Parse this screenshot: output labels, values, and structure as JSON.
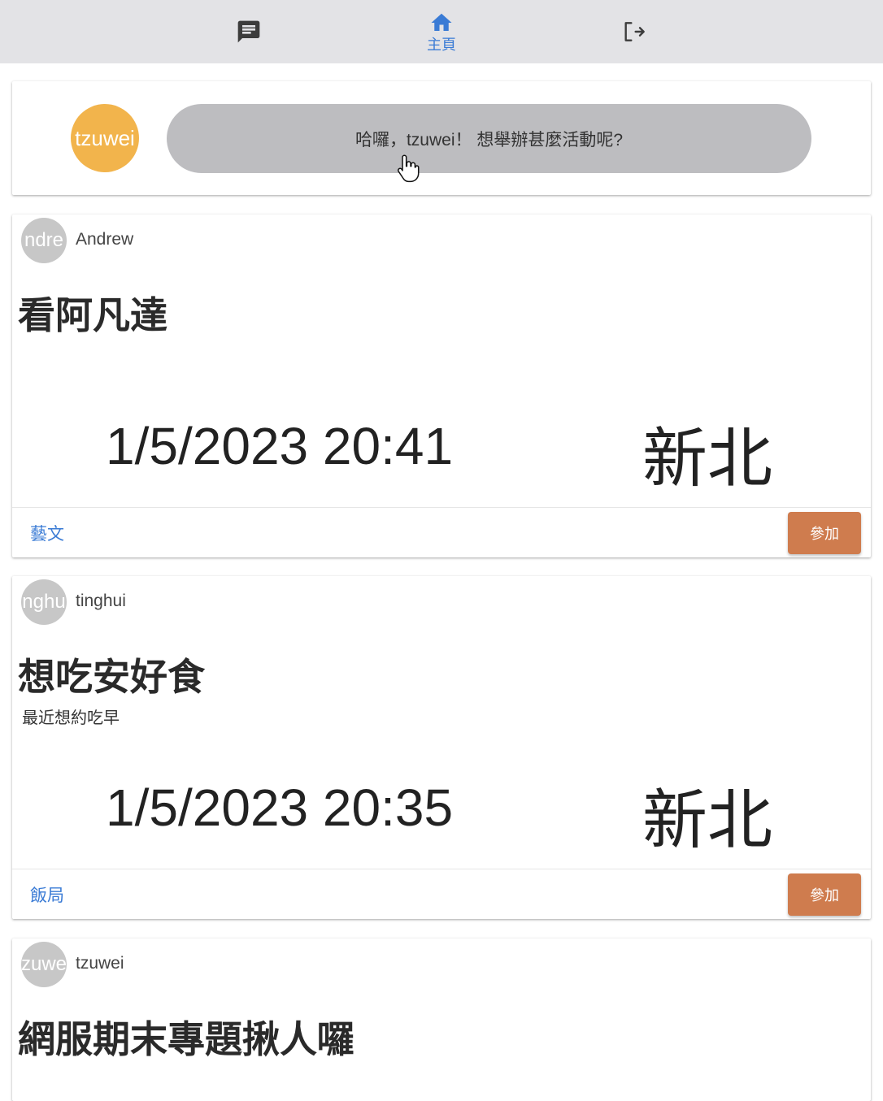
{
  "nav": {
    "items": [
      {
        "icon": "chat-icon",
        "label": ""
      },
      {
        "icon": "home-icon",
        "label": "主頁"
      },
      {
        "icon": "logout-icon",
        "label": ""
      }
    ],
    "active_color": "#3a7bd5"
  },
  "composer": {
    "avatar_text": "tzuwei",
    "avatar_color": "#f2b44c",
    "prompt": "哈囉，tzuwei！ 想舉辦甚麼活動呢?"
  },
  "posts": [
    {
      "avatar_text": "ndre",
      "author": "Andrew",
      "title": "看阿凡達",
      "description": "",
      "datetime": "1/5/2023 20:41",
      "location": "新北",
      "tag": "藝文",
      "join_label": "參加"
    },
    {
      "avatar_text": "nghu",
      "author": "tinghui",
      "title": "想吃安好食",
      "description": "最近想約吃早",
      "datetime": "1/5/2023 20:35",
      "location": "新北",
      "tag": "飯局",
      "join_label": "參加"
    },
    {
      "avatar_text": "zuwe",
      "author": "tzuwei",
      "title": "網服期末專題揪人囉"
    }
  ],
  "colors": {
    "join_button": "#cf7c4e",
    "tag_link": "#3a7bd5",
    "nav_bg": "#e3e3e6"
  }
}
